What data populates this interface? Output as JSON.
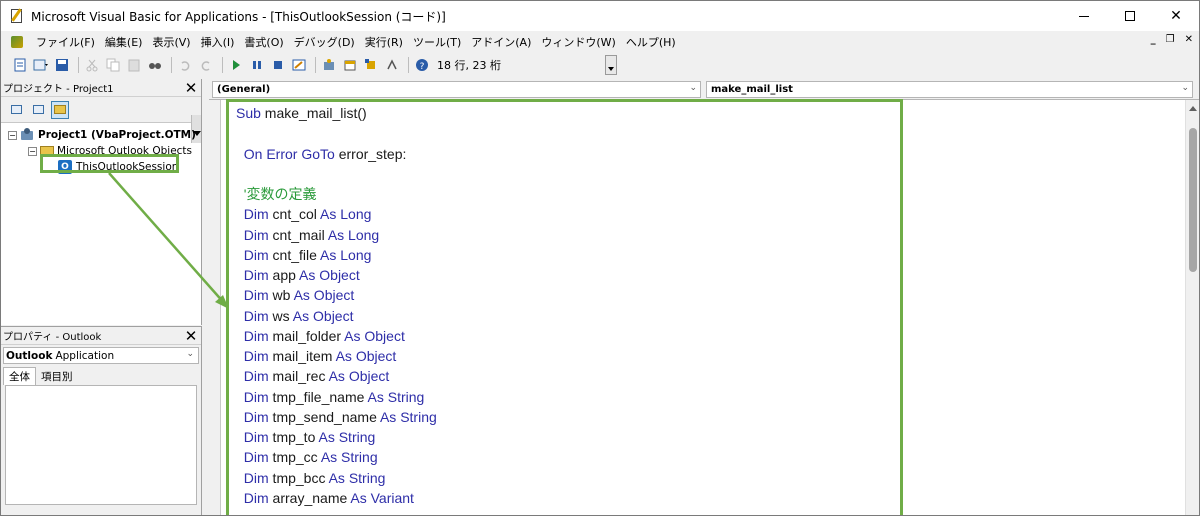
{
  "window": {
    "title": "Microsoft Visual Basic for Applications - [ThisOutlookSession (コード)]",
    "min_icon": "minimize-icon",
    "max_icon": "maximize-icon",
    "close_symbol": "✕"
  },
  "menu": {
    "items": [
      "ファイル(F)",
      "編集(E)",
      "表示(V)",
      "挿入(I)",
      "書式(O)",
      "デバッグ(D)",
      "実行(R)",
      "ツール(T)",
      "アドイン(A)",
      "ウィンドウ(W)",
      "ヘルプ(H)"
    ],
    "mdi_minimize": "_",
    "mdi_restore": "❐",
    "mdi_close": "✕"
  },
  "toolbar": {
    "cursor_position": "18 行, 23 桁"
  },
  "project_panel": {
    "title": "プロジェクト - Project1",
    "close_symbol": "✕",
    "tree": {
      "project": "Project1 (VbaProject.OTM)",
      "folder": "Microsoft Outlook Objects",
      "item": "ThisOutlookSession"
    },
    "expander_minus": "−"
  },
  "properties_panel": {
    "title": "プロパティ - Outlook",
    "close_symbol": "✕",
    "object_name": "Outlook",
    "object_type": "Application",
    "tabs": [
      "全体",
      "項目別"
    ]
  },
  "code_window": {
    "object_combo": "(General)",
    "procedure_combo": "make_mail_list",
    "lines": [
      {
        "kw": "Sub",
        "rest": " make_mail_list()"
      },
      {
        "kw": "",
        "rest": ""
      },
      {
        "kw": "On Error GoTo",
        "rest": " error_step:"
      },
      {
        "kw": "",
        "rest": ""
      },
      {
        "comment": "'変数の定義"
      },
      {
        "kw": "Dim",
        "name": "cnt_col",
        "as": "As Long"
      },
      {
        "kw": "Dim",
        "name": "cnt_mail",
        "as": "As Long"
      },
      {
        "kw": "Dim",
        "name": "cnt_file",
        "as": "As Long"
      },
      {
        "kw": "Dim",
        "name": "app",
        "as": "As Object"
      },
      {
        "kw": "Dim",
        "name": "wb",
        "as": "As Object"
      },
      {
        "kw": "Dim",
        "name": "ws",
        "as": "As Object"
      },
      {
        "kw": "Dim",
        "name": "mail_folder",
        "as": "As Object"
      },
      {
        "kw": "Dim",
        "name": "mail_item",
        "as": "As Object"
      },
      {
        "kw": "Dim",
        "name": "mail_rec",
        "as": "As Object"
      },
      {
        "kw": "Dim",
        "name": "tmp_file_name",
        "as": "As String"
      },
      {
        "kw": "Dim",
        "name": "tmp_send_name",
        "as": "As String"
      },
      {
        "kw": "Dim",
        "name": "tmp_to",
        "as": "As String"
      },
      {
        "kw": "Dim",
        "name": "tmp_cc",
        "as": "As String"
      },
      {
        "kw": "Dim",
        "name": "tmp_bcc",
        "as": "As String"
      },
      {
        "kw": "Dim",
        "name": "array_name",
        "as": "As Variant"
      }
    ]
  },
  "colors": {
    "keyword": "#2e2ea8",
    "comment": "#2a9a3a",
    "highlight_frame": "#70ad47"
  }
}
